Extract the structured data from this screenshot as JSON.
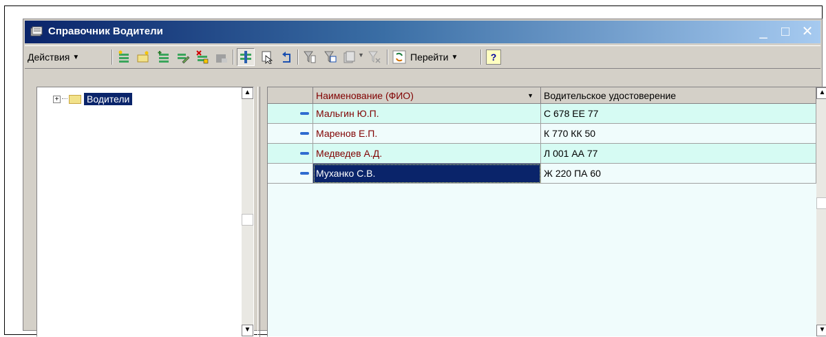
{
  "window": {
    "title": "Справочник Водители"
  },
  "titlebar_buttons": {
    "minimize": "_",
    "maximize": "□",
    "close": "✕"
  },
  "toolbar": {
    "actions_label": "Действия",
    "goto_label": "Перейти",
    "help_label": "?"
  },
  "tree": {
    "root_label": "Водители"
  },
  "table": {
    "columns": [
      "Наименование (ФИО)",
      "Водительское удостоверение"
    ],
    "rows": [
      {
        "name": "Мальгин Ю.П.",
        "license": "С 678 ЕЕ 77"
      },
      {
        "name": "Маренов Е.П.",
        "license": "К 770 КК 50"
      },
      {
        "name": "Медведев А.Д.",
        "license": "Л 001 АА 77"
      },
      {
        "name": "Муханко С.В.",
        "license": "Ж 220 ПА 60"
      }
    ],
    "selected_row": 3
  },
  "colors": {
    "title_start": "#0a246a",
    "title_end": "#a6caf0",
    "row_alt": "#d6fbf3",
    "row_base": "#f0fcfc",
    "name_text": "#800000",
    "selection": "#0a246a"
  },
  "icons": [
    "window-icon",
    "add-icon",
    "add-folder-icon",
    "add-copy-icon",
    "edit-icon",
    "delete-icon",
    "save-disabled-icon",
    "hierarchy-toggle-icon",
    "select-icon",
    "up-level-icon",
    "filter-icon",
    "filter-value-icon",
    "filter-history-icon",
    "filter-off-icon",
    "refresh-icon",
    "help-icon"
  ]
}
